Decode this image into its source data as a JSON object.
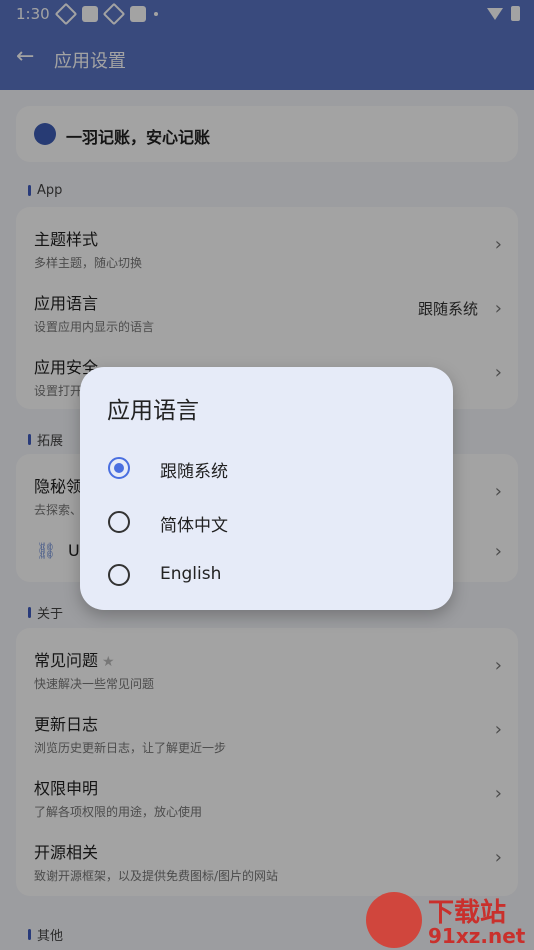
{
  "status_bar": {
    "time": "1:30"
  },
  "app_bar": {
    "title": "应用设置",
    "back_icon": "arrow-left-icon"
  },
  "banner": {
    "text": "一羽记账，安心记账"
  },
  "sections": {
    "app": "App",
    "extend": "拓展",
    "about": "关于",
    "other": "其他"
  },
  "app_items": [
    {
      "title": "主题样式",
      "subtitle": "多样主题，随心切换"
    },
    {
      "title": "应用语言",
      "subtitle": "设置应用内显示的语言",
      "value": "跟随系统"
    },
    {
      "title": "应用安全",
      "subtitle": "设置打开"
    }
  ],
  "extend_items": [
    {
      "title": "隐秘领",
      "subtitle": "去探索、"
    },
    {
      "title": "U"
    }
  ],
  "about_items": [
    {
      "title": "常见问题",
      "subtitle": "快速解决一些常见问题"
    },
    {
      "title": "更新日志",
      "subtitle": "浏览历史更新日志，让了解更近一步"
    },
    {
      "title": "权限申明",
      "subtitle": "了解各项权限的用途，放心使用"
    },
    {
      "title": "开源相关",
      "subtitle": "致谢开源框架，以及提供免费图标/图片的网站"
    }
  ],
  "dialog": {
    "title": "应用语言",
    "options": [
      {
        "label": "跟随系统",
        "selected": true
      },
      {
        "label": "简体中文",
        "selected": false
      },
      {
        "label": "English",
        "selected": false
      }
    ]
  },
  "watermark": {
    "top": "下载站",
    "bottom": "91xz.net"
  },
  "colors": {
    "primary": "#5a74c4",
    "radio_selected": "#4a6fe0",
    "dialog_bg": "#e6ebf8"
  }
}
